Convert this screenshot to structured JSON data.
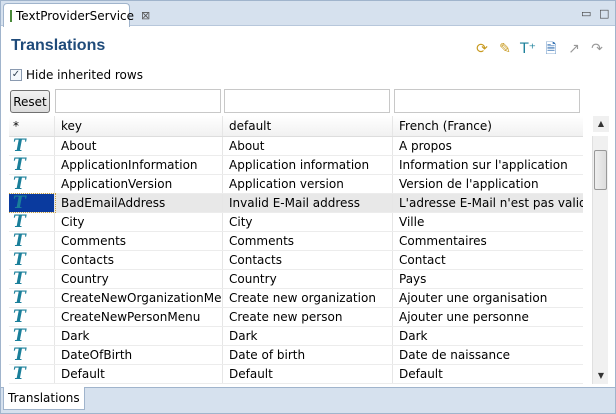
{
  "tab": {
    "title": "TextProviderService",
    "close": "⊠"
  },
  "window": {
    "minimize": "▭",
    "maximize": "□"
  },
  "title": "Translations",
  "toolbar": [
    {
      "icon": "refresh-icon",
      "glyph": "⟳"
    },
    {
      "icon": "edit-icon",
      "glyph": "✎"
    },
    {
      "icon": "add-text-icon",
      "glyph": "T⁺"
    },
    {
      "icon": "new-document-icon",
      "glyph": "🗎"
    },
    {
      "icon": "export-icon",
      "glyph": "↗"
    },
    {
      "icon": "redo-icon",
      "glyph": "↷"
    }
  ],
  "hide_inherited": {
    "label": "Hide inherited rows",
    "checked": true
  },
  "reset_label": "Reset",
  "columns": [
    "*",
    "key",
    "default",
    "French (France)"
  ],
  "rows": [
    [
      "About",
      "About",
      "A propos"
    ],
    [
      "ApplicationInformation",
      "Application information",
      "Information sur l'application"
    ],
    [
      "ApplicationVersion",
      "Application version",
      "Version de l'application"
    ],
    [
      "BadEmailAddress",
      "Invalid E-Mail address",
      "L'adresse E-Mail n'est pas valide"
    ],
    [
      "City",
      "City",
      "Ville"
    ],
    [
      "Comments",
      "Comments",
      "Commentaires"
    ],
    [
      "Contacts",
      "Contacts",
      "Contact"
    ],
    [
      "Country",
      "Country",
      "Pays"
    ],
    [
      "CreateNewOrganizationMe...",
      "Create new organization",
      "Ajouter une organisation"
    ],
    [
      "CreateNewPersonMenu",
      "Create new person",
      "Ajouter une personne"
    ],
    [
      "Dark",
      "Dark",
      "Dark"
    ],
    [
      "DateOfBirth",
      "Date of birth",
      "Date de naissance"
    ],
    [
      "Default",
      "Default",
      "Default"
    ]
  ],
  "selected_row": 3,
  "bottom_tab": "Translations",
  "colors": {
    "title": "#1f4b7a",
    "icon_T": "#1a7f9a",
    "selection": "#0a3a9e"
  }
}
